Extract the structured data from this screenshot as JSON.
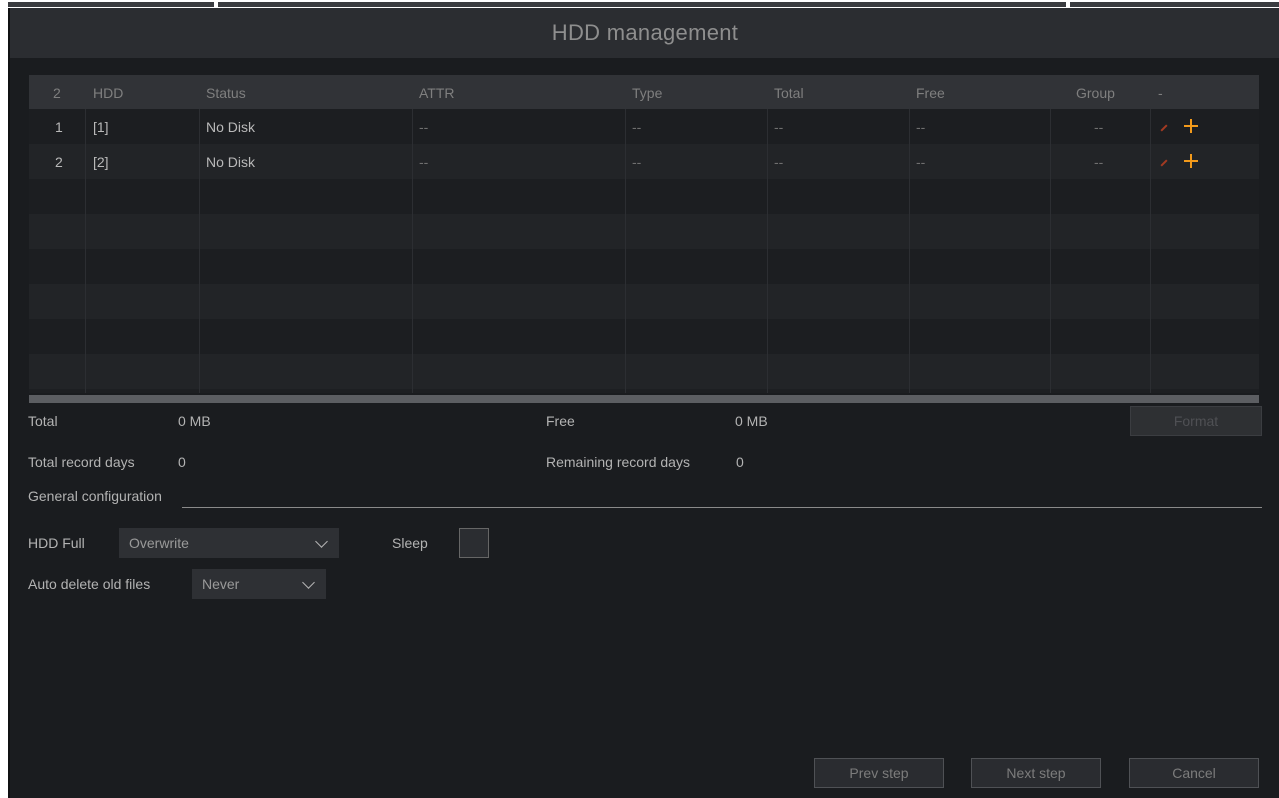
{
  "window": {
    "title": "HDD management"
  },
  "table": {
    "headers": [
      "2",
      "HDD",
      "Status",
      "ATTR",
      "Type",
      "Total",
      "Free",
      "Group",
      "-"
    ],
    "rows": [
      {
        "index": "1",
        "hdd": "[1]",
        "status": "No Disk",
        "attr": "--",
        "type": "--",
        "total": "--",
        "free": "--",
        "group": "--"
      },
      {
        "index": "2",
        "hdd": "[2]",
        "status": "No Disk",
        "attr": "--",
        "type": "--",
        "total": "--",
        "free": "--",
        "group": "--"
      }
    ],
    "action_icons": [
      "edit-icon",
      "add-icon"
    ],
    "colors": {
      "edit": "#a33a22",
      "add": "#f29a1b"
    }
  },
  "summary": {
    "total_label": "Total",
    "total_value": "0 MB",
    "free_label": "Free",
    "free_value": "0 MB",
    "format_label": "Format",
    "record_days_label": "Total record days",
    "record_days_value": "0",
    "remaining_days_label": "Remaining record days",
    "remaining_days_value": "0"
  },
  "general": {
    "section_title": "General configuration",
    "hdd_full_label": "HDD Full",
    "hdd_full_value": "Overwrite",
    "sleep_label": "Sleep",
    "auto_delete_label": "Auto delete old files",
    "auto_delete_value": "Never"
  },
  "footer": {
    "prev": "Prev step",
    "next": "Next step",
    "cancel": "Cancel"
  }
}
